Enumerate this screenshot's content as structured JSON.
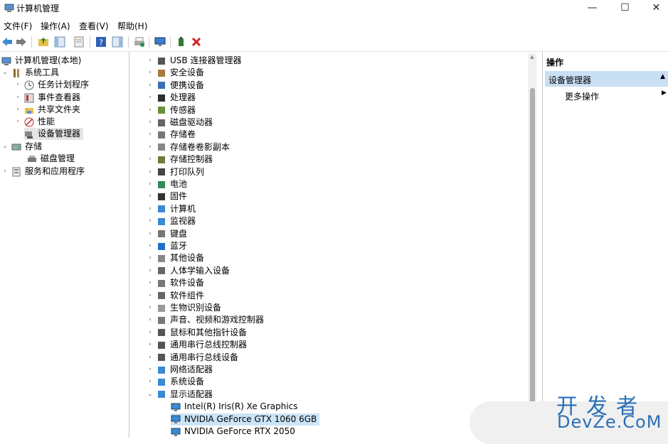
{
  "window": {
    "title": "计算机管理",
    "min": "—",
    "max": "☐",
    "close": "✕"
  },
  "menu": [
    "文件(F)",
    "操作(A)",
    "查看(V)",
    "帮助(H)"
  ],
  "left_tree": {
    "root": "计算机管理(本地)",
    "system_tools": "系统工具",
    "system_children": [
      "任务计划程序",
      "事件查看器",
      "共享文件夹",
      "性能",
      "设备管理器"
    ],
    "storage": "存储",
    "storage_children": [
      "磁盘管理"
    ],
    "services": "服务和应用程序"
  },
  "devices": [
    "USB 连接器管理器",
    "安全设备",
    "便携设备",
    "处理器",
    "传感器",
    "磁盘驱动器",
    "存储卷",
    "存储卷卷影副本",
    "存储控制器",
    "打印队列",
    "电池",
    "固件",
    "计算机",
    "监视器",
    "键盘",
    "蓝牙",
    "其他设备",
    "人体学输入设备",
    "软件设备",
    "软件组件",
    "生物识别设备",
    "声音、视频和游戏控制器",
    "鼠标和其他指针设备",
    "通用串行总线控制器",
    "通用串行总线设备",
    "网络适配器",
    "系统设备",
    "显示适配器"
  ],
  "display_adapters": [
    "Intel(R) Iris(R) Xe Graphics",
    "NVIDIA GeForce GTX 1060 6GB",
    "NVIDIA GeForce RTX 2050"
  ],
  "actions": {
    "title": "操作",
    "section": "设备管理器",
    "more": "更多操作"
  },
  "watermark": {
    "top": "开发者",
    "bottom": "DevZe.CoM"
  }
}
